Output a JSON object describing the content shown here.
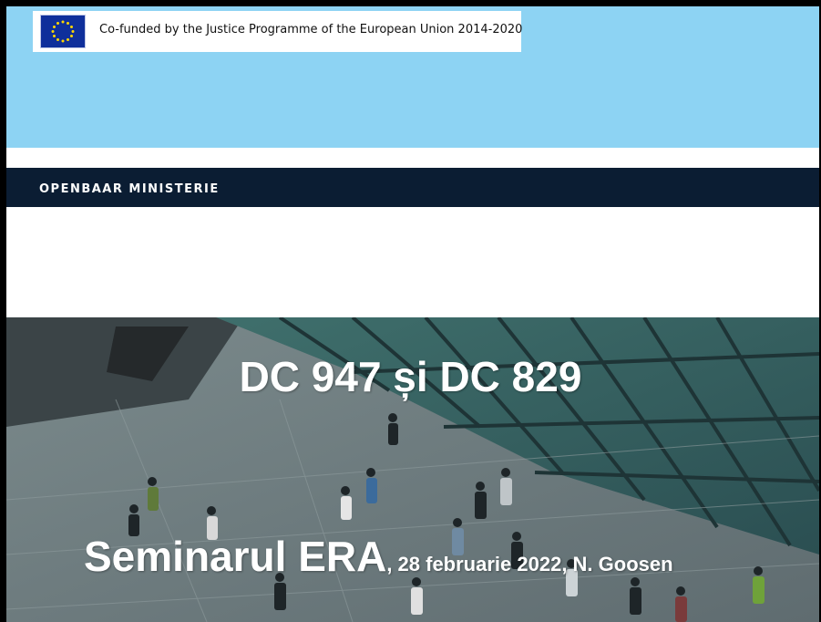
{
  "header": {
    "funding_text": "Co-funded by the Justice Programme of the European Union 2014-2020",
    "flag_icon": "eu-flag-icon",
    "band_color": "#8dd3f3"
  },
  "ministry": {
    "name": "OPENBAAR MINISTERIE",
    "bar_color": "#0b1d33"
  },
  "slide": {
    "title": "DC 947 și DC 829",
    "subtitle_main": "Seminarul ERA",
    "subtitle_details": ", 28 februarie 2022, N. Goosen"
  }
}
